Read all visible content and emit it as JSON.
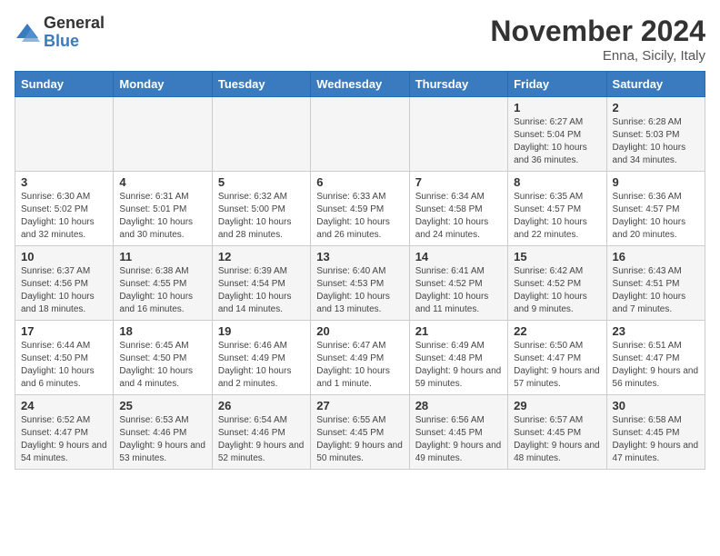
{
  "logo": {
    "general": "General",
    "blue": "Blue"
  },
  "title": "November 2024",
  "location": "Enna, Sicily, Italy",
  "days_of_week": [
    "Sunday",
    "Monday",
    "Tuesday",
    "Wednesday",
    "Thursday",
    "Friday",
    "Saturday"
  ],
  "weeks": [
    [
      {
        "day": "",
        "info": ""
      },
      {
        "day": "",
        "info": ""
      },
      {
        "day": "",
        "info": ""
      },
      {
        "day": "",
        "info": ""
      },
      {
        "day": "",
        "info": ""
      },
      {
        "day": "1",
        "info": "Sunrise: 6:27 AM\nSunset: 5:04 PM\nDaylight: 10 hours and 36 minutes."
      },
      {
        "day": "2",
        "info": "Sunrise: 6:28 AM\nSunset: 5:03 PM\nDaylight: 10 hours and 34 minutes."
      }
    ],
    [
      {
        "day": "3",
        "info": "Sunrise: 6:30 AM\nSunset: 5:02 PM\nDaylight: 10 hours and 32 minutes."
      },
      {
        "day": "4",
        "info": "Sunrise: 6:31 AM\nSunset: 5:01 PM\nDaylight: 10 hours and 30 minutes."
      },
      {
        "day": "5",
        "info": "Sunrise: 6:32 AM\nSunset: 5:00 PM\nDaylight: 10 hours and 28 minutes."
      },
      {
        "day": "6",
        "info": "Sunrise: 6:33 AM\nSunset: 4:59 PM\nDaylight: 10 hours and 26 minutes."
      },
      {
        "day": "7",
        "info": "Sunrise: 6:34 AM\nSunset: 4:58 PM\nDaylight: 10 hours and 24 minutes."
      },
      {
        "day": "8",
        "info": "Sunrise: 6:35 AM\nSunset: 4:57 PM\nDaylight: 10 hours and 22 minutes."
      },
      {
        "day": "9",
        "info": "Sunrise: 6:36 AM\nSunset: 4:57 PM\nDaylight: 10 hours and 20 minutes."
      }
    ],
    [
      {
        "day": "10",
        "info": "Sunrise: 6:37 AM\nSunset: 4:56 PM\nDaylight: 10 hours and 18 minutes."
      },
      {
        "day": "11",
        "info": "Sunrise: 6:38 AM\nSunset: 4:55 PM\nDaylight: 10 hours and 16 minutes."
      },
      {
        "day": "12",
        "info": "Sunrise: 6:39 AM\nSunset: 4:54 PM\nDaylight: 10 hours and 14 minutes."
      },
      {
        "day": "13",
        "info": "Sunrise: 6:40 AM\nSunset: 4:53 PM\nDaylight: 10 hours and 13 minutes."
      },
      {
        "day": "14",
        "info": "Sunrise: 6:41 AM\nSunset: 4:52 PM\nDaylight: 10 hours and 11 minutes."
      },
      {
        "day": "15",
        "info": "Sunrise: 6:42 AM\nSunset: 4:52 PM\nDaylight: 10 hours and 9 minutes."
      },
      {
        "day": "16",
        "info": "Sunrise: 6:43 AM\nSunset: 4:51 PM\nDaylight: 10 hours and 7 minutes."
      }
    ],
    [
      {
        "day": "17",
        "info": "Sunrise: 6:44 AM\nSunset: 4:50 PM\nDaylight: 10 hours and 6 minutes."
      },
      {
        "day": "18",
        "info": "Sunrise: 6:45 AM\nSunset: 4:50 PM\nDaylight: 10 hours and 4 minutes."
      },
      {
        "day": "19",
        "info": "Sunrise: 6:46 AM\nSunset: 4:49 PM\nDaylight: 10 hours and 2 minutes."
      },
      {
        "day": "20",
        "info": "Sunrise: 6:47 AM\nSunset: 4:49 PM\nDaylight: 10 hours and 1 minute."
      },
      {
        "day": "21",
        "info": "Sunrise: 6:49 AM\nSunset: 4:48 PM\nDaylight: 9 hours and 59 minutes."
      },
      {
        "day": "22",
        "info": "Sunrise: 6:50 AM\nSunset: 4:47 PM\nDaylight: 9 hours and 57 minutes."
      },
      {
        "day": "23",
        "info": "Sunrise: 6:51 AM\nSunset: 4:47 PM\nDaylight: 9 hours and 56 minutes."
      }
    ],
    [
      {
        "day": "24",
        "info": "Sunrise: 6:52 AM\nSunset: 4:47 PM\nDaylight: 9 hours and 54 minutes."
      },
      {
        "day": "25",
        "info": "Sunrise: 6:53 AM\nSunset: 4:46 PM\nDaylight: 9 hours and 53 minutes."
      },
      {
        "day": "26",
        "info": "Sunrise: 6:54 AM\nSunset: 4:46 PM\nDaylight: 9 hours and 52 minutes."
      },
      {
        "day": "27",
        "info": "Sunrise: 6:55 AM\nSunset: 4:45 PM\nDaylight: 9 hours and 50 minutes."
      },
      {
        "day": "28",
        "info": "Sunrise: 6:56 AM\nSunset: 4:45 PM\nDaylight: 9 hours and 49 minutes."
      },
      {
        "day": "29",
        "info": "Sunrise: 6:57 AM\nSunset: 4:45 PM\nDaylight: 9 hours and 48 minutes."
      },
      {
        "day": "30",
        "info": "Sunrise: 6:58 AM\nSunset: 4:45 PM\nDaylight: 9 hours and 47 minutes."
      }
    ]
  ]
}
